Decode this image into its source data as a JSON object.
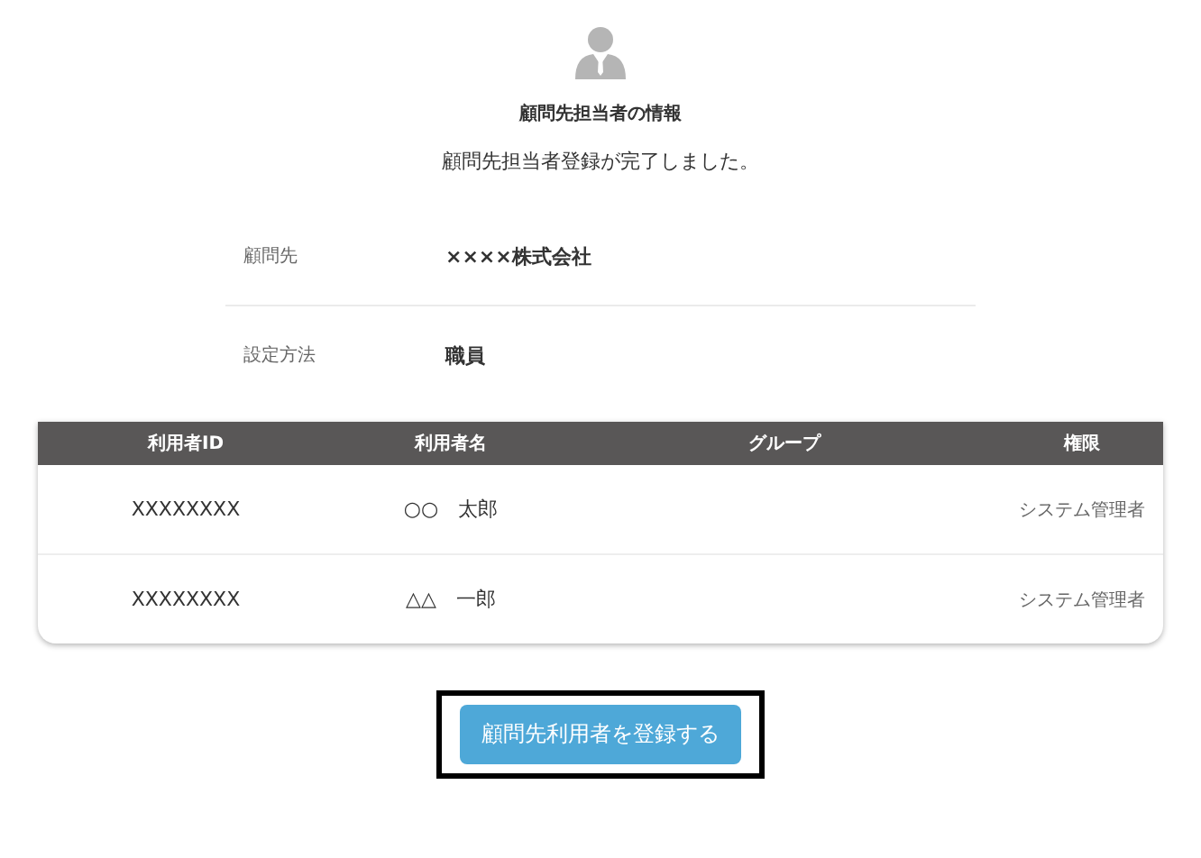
{
  "title": "顧問先担当者の情報",
  "message": "顧問先担当者登録が完了しました。",
  "details": [
    {
      "label": "顧問先",
      "value": "××××株式会社"
    },
    {
      "label": "設定方法",
      "value": "職員"
    }
  ],
  "table": {
    "columns": [
      "利用者ID",
      "利用者名",
      "グループ",
      "権限"
    ],
    "rows": [
      [
        "XXXXXXXX",
        "○○　太郎",
        "",
        "システム管理者"
      ],
      [
        "XXXXXXXX",
        "△△　一郎",
        "",
        "システム管理者"
      ]
    ]
  },
  "button": "顧問先利用者を登録する"
}
